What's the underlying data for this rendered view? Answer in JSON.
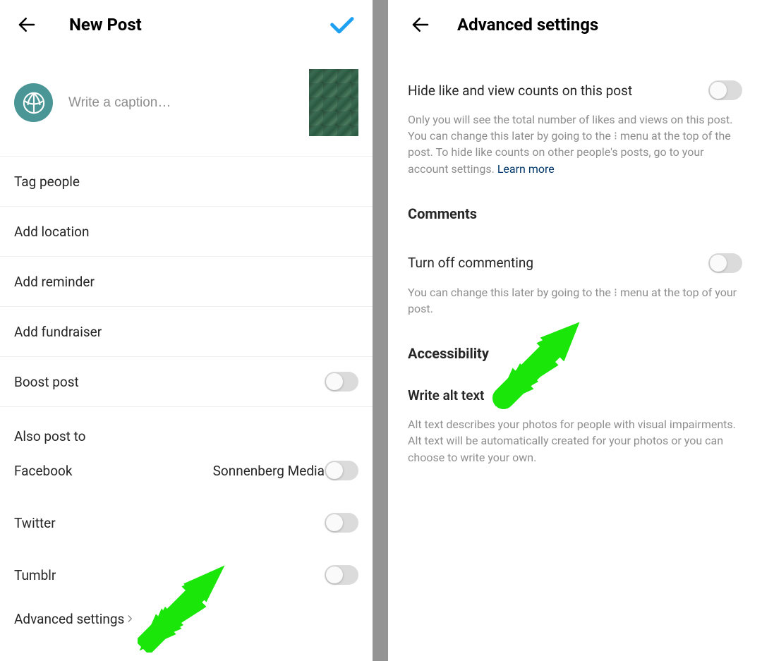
{
  "left": {
    "header_title": "New Post",
    "caption_placeholder": "Write a caption…",
    "rows": {
      "tag_people": "Tag people",
      "add_location": "Add location",
      "add_reminder": "Add reminder",
      "add_fundraiser": "Add fundraiser",
      "boost_post": "Boost post"
    },
    "also_post_to": "Also post to",
    "share": {
      "facebook": "Facebook",
      "facebook_account": "Sonnenberg Media",
      "twitter": "Twitter",
      "tumblr": "Tumblr"
    },
    "advanced_settings": "Advanced settings"
  },
  "right": {
    "header_title": "Advanced settings",
    "hide_like": {
      "label": "Hide like and view counts on this post",
      "description": "Only you will see the total number of likes and views on this post. You can change this later by going to the ⁝ menu at the top of the post. To hide like counts on other people's posts, go to your account settings.",
      "learn_more": "Learn more"
    },
    "comments_heading": "Comments",
    "turn_off_commenting": {
      "label": "Turn off commenting",
      "description": "You can change this later by going to the ⁝ menu at the top of your post."
    },
    "accessibility_heading": "Accessibility",
    "write_alt_text": {
      "label": "Write alt text",
      "description": "Alt text describes your photos for people with visual impairments. Alt text will be automatically created for your photos or you can choose to write your own."
    }
  }
}
